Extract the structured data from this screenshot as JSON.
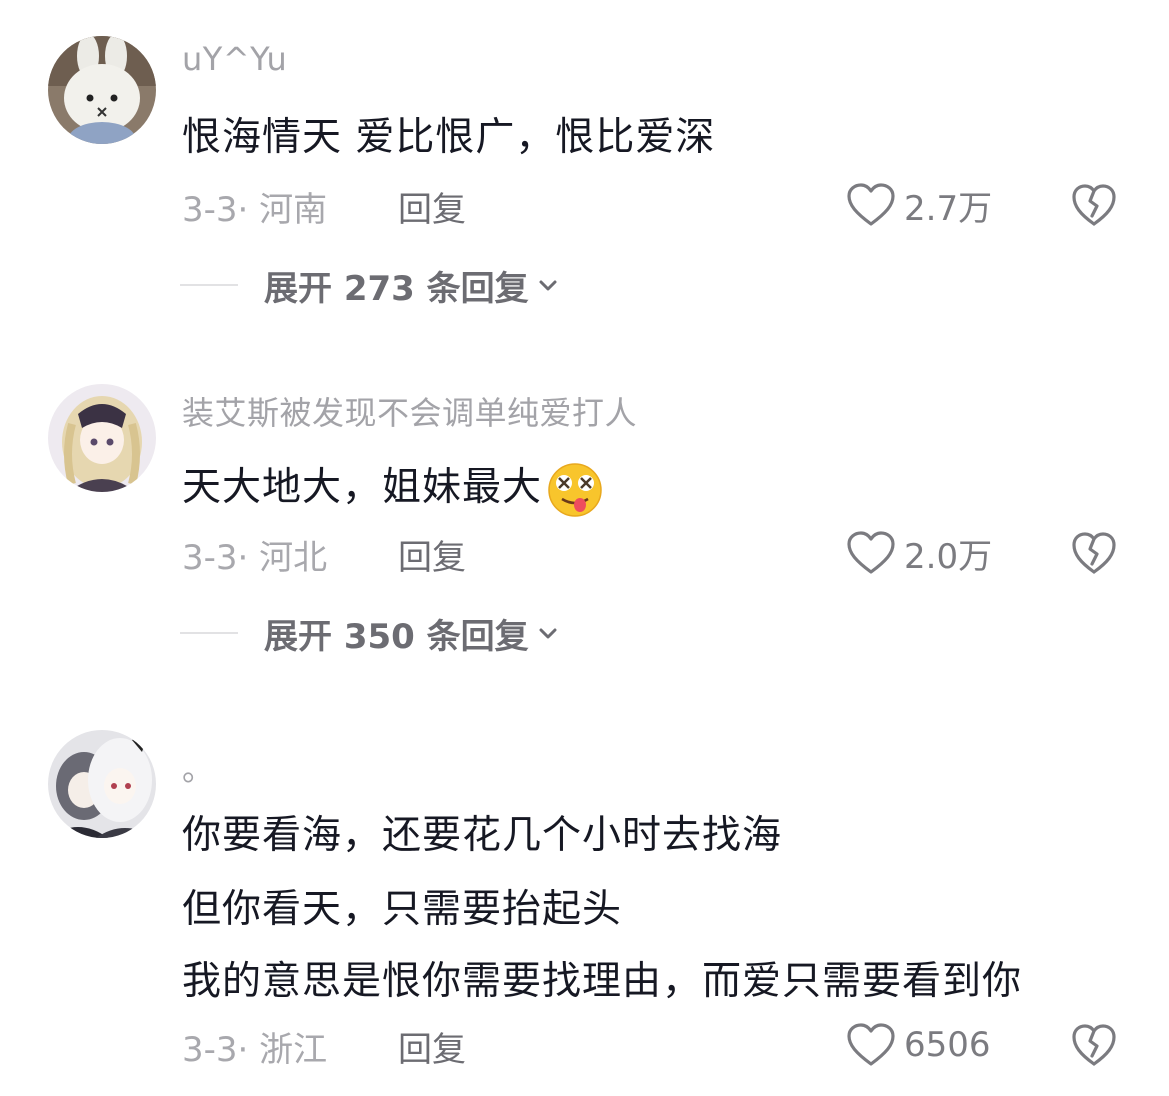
{
  "comments": [
    {
      "username": "uY^Yu",
      "lines": [
        "恨海情天  爱比恨广，恨比爱深"
      ],
      "meta": "3-3· 河南",
      "reply_label": "回复",
      "likes": "2.7万",
      "expand_label": "展开 273 条回复",
      "avatar_icon": "bunny-plush-avatar"
    },
    {
      "username": "装艾斯被发现不会调单纯爱打人",
      "lines": [
        "天大地大，姐妹最大"
      ],
      "emoji": "dizzy-tongue-emoji",
      "meta": "3-3· 河北",
      "reply_label": "回复",
      "likes": "2.0万",
      "expand_label": "展开 350 条回复",
      "avatar_icon": "anime-girl-avatar"
    },
    {
      "username": "。",
      "lines": [
        "你要看海，还要花几个小时去找海",
        "但你看天，只需要抬起头",
        "我的意思是恨你需要找理由，而爱只需要看到你"
      ],
      "meta": "3-3· 浙江",
      "reply_label": "回复",
      "likes": "6506",
      "avatar_icon": "anime-pair-avatar"
    }
  ],
  "colors": {
    "primary_text": "#161823",
    "secondary_text": "#a8a8ad",
    "action_text": "#6c6c72",
    "background": "#ffffff"
  }
}
